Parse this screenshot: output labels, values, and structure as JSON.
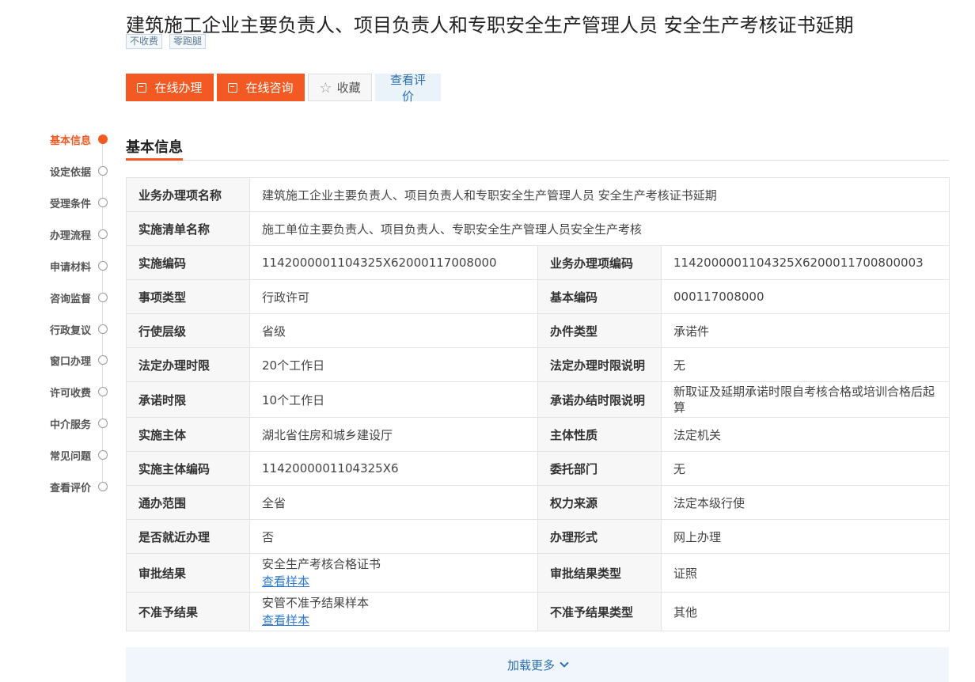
{
  "header": {
    "title": "建筑施工企业主要负责人、项目负责人和专职安全生产管理人员 安全生产考核证书延期",
    "tags": [
      "不收费",
      "零跑腿"
    ]
  },
  "actions": {
    "online_handle": "在线办理",
    "online_consult": "在线咨询",
    "favorite": "收藏",
    "view_eval": "查看评价"
  },
  "sidenav": {
    "items": [
      "基本信息",
      "设定依据",
      "受理条件",
      "办理流程",
      "申请材料",
      "咨询监督",
      "行政复议",
      "窗口办理",
      "许可收费",
      "中介服务",
      "常见问题",
      "查看评价"
    ],
    "active_index": 0
  },
  "section": {
    "title": "基本信息"
  },
  "info": {
    "r0": {
      "l1": "业务办理项名称",
      "v1": "建筑施工企业主要负责人、项目负责人和专职安全生产管理人员 安全生产考核证书延期"
    },
    "r1": {
      "l1": "实施清单名称",
      "v1": "施工单位主要负责人、项目负责人、专职安全生产管理人员安全生产考核"
    },
    "r2": {
      "l1": "实施编码",
      "v1": "1142000001104325X62000117008000",
      "l2": "业务办理项编码",
      "v2": "1142000001104325X6200011700800003"
    },
    "r3": {
      "l1": "事项类型",
      "v1": "行政许可",
      "l2": "基本编码",
      "v2": "000117008000"
    },
    "r4": {
      "l1": "行使层级",
      "v1": "省级",
      "l2": "办件类型",
      "v2": "承诺件"
    },
    "r5": {
      "l1": "法定办理时限",
      "v1": "20个工作日",
      "l2": "法定办理时限说明",
      "v2": "无"
    },
    "r6": {
      "l1": "承诺时限",
      "v1": "10个工作日",
      "l2": "承诺办结时限说明",
      "v2": "新取证及延期承诺时限自考核合格或培训合格后起算"
    },
    "r7": {
      "l1": "实施主体",
      "v1": "湖北省住房和城乡建设厅",
      "l2": "主体性质",
      "v2": "法定机关"
    },
    "r8": {
      "l1": "实施主体编码",
      "v1": "1142000001104325X6",
      "l2": "委托部门",
      "v2": "无"
    },
    "r9": {
      "l1": "通办范围",
      "v1": "全省",
      "l2": "权力来源",
      "v2": "法定本级行使"
    },
    "r10": {
      "l1": "是否就近办理",
      "v1": "否",
      "l2": "办理形式",
      "v2": "网上办理"
    },
    "r11": {
      "l1": "审批结果",
      "v1": "安全生产考核合格证书",
      "link1": "查看样本",
      "l2": "审批结果类型",
      "v2": "证照"
    },
    "r12": {
      "l1": "不准予结果",
      "v1": "安管不准予结果样本",
      "link1": "查看样本",
      "l2": "不准予结果类型",
      "v2": "其他"
    }
  },
  "load_more": "加载更多",
  "colors": {
    "accent": "#f35a23",
    "link": "#2d7bd4"
  }
}
